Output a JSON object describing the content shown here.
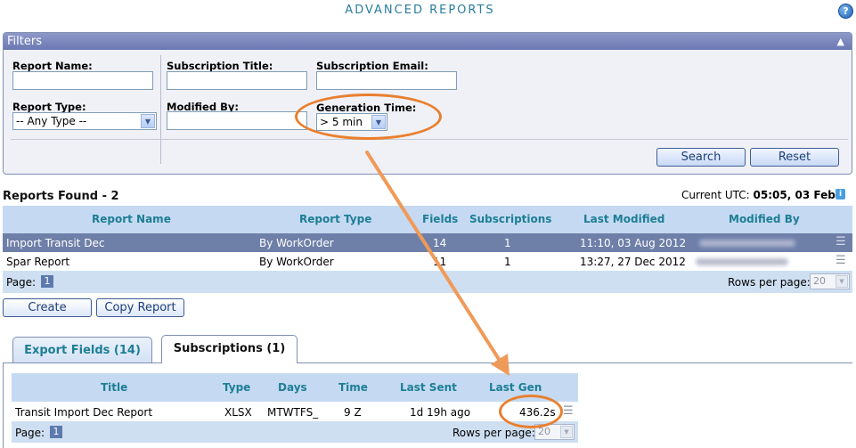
{
  "header": {
    "title": "ADVANCED REPORTS",
    "help_icon": "question-icon"
  },
  "filters": {
    "title": "Filters",
    "collapse_glyph": "▲",
    "report_name_label": "Report Name:",
    "report_name_value": "",
    "report_type_label": "Report Type:",
    "report_type_value": "-- Any Type --",
    "subscription_title_label": "Subscription Title:",
    "subscription_title_value": "",
    "subscription_email_label": "Subscription Email:",
    "subscription_email_value": "",
    "modified_by_label": "Modified By:",
    "modified_by_value": "",
    "generation_time_label": "Generation Time:",
    "generation_time_value": "> 5 min",
    "search_label": "Search",
    "reset_label": "Reset"
  },
  "reports": {
    "found_label": "Reports Found - 2",
    "utc_label": "Current UTC:",
    "utc_value": "05:05, 03 Feb",
    "columns": [
      "Report Name",
      "Report Type",
      "Fields",
      "Subscriptions",
      "Last Modified",
      "Modified By"
    ],
    "rows": [
      {
        "name": "Import Transit Dec",
        "type": "By WorkOrder",
        "fields": "14",
        "subscriptions": "1",
        "last_modified": "11:10, 03 Aug 2012"
      },
      {
        "name": "Spar Report",
        "type": "By WorkOrder",
        "fields": "11",
        "subscriptions": "1",
        "last_modified": "13:27, 27 Dec 2012"
      }
    ],
    "page_label": "Page:",
    "page_number": "1",
    "rows_per_page_label": "Rows per page:",
    "rows_per_page_value": "20",
    "create_label": "Create",
    "copy_label": "Copy Report"
  },
  "tabs": {
    "export_label": "Export Fields (14)",
    "subscriptions_label": "Subscriptions (1)"
  },
  "subscriptions": {
    "columns": [
      "Title",
      "Type",
      "Days",
      "Time",
      "Last Sent",
      "Last Gen"
    ],
    "rows": [
      {
        "title": "Transit Import Dec Report",
        "type": "XLSX",
        "days": "MTWTFS_",
        "time": "9 Z",
        "last_sent": "1d 19h ago",
        "last_gen": "436.2s"
      }
    ],
    "page_label": "Page:",
    "page_number": "1",
    "rows_per_page_label": "Rows per page:",
    "rows_per_page_value": "20"
  },
  "colors": {
    "accent": "#1d7e95",
    "annotation": "#e97f2e",
    "header_bar": "#6b78b2"
  }
}
